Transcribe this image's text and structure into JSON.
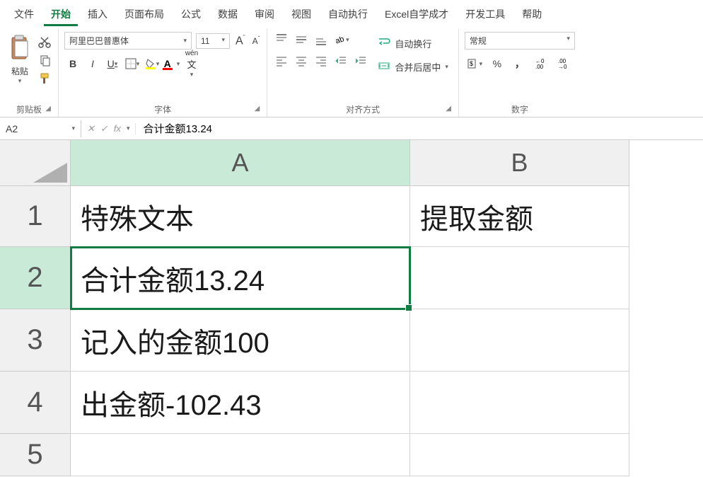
{
  "menu": {
    "items": [
      "文件",
      "开始",
      "插入",
      "页面布局",
      "公式",
      "数据",
      "审阅",
      "视图",
      "自动执行",
      "Excel自学成才",
      "开发工具",
      "帮助"
    ],
    "active_index": 1
  },
  "ribbon": {
    "clipboard": {
      "paste_label": "粘贴",
      "group_label": "剪贴板"
    },
    "font": {
      "font_name": "阿里巴巴普惠体",
      "font_size": "11",
      "group_label": "字体",
      "bold": "B",
      "italic": "I",
      "underline": "U",
      "wen": "wén"
    },
    "alignment": {
      "wrap_label": "自动换行",
      "merge_label": "合并后居中",
      "group_label": "对齐方式"
    },
    "number": {
      "format": "常规",
      "percent": "%",
      "comma": "，",
      "group_label": "数字"
    }
  },
  "formula_bar": {
    "name_box": "A2",
    "fx": "fx",
    "formula": "合计金额13.24"
  },
  "grid": {
    "columns": [
      "A",
      "B"
    ],
    "rows": [
      {
        "num": "1",
        "a": "特殊文本",
        "b": "提取金额"
      },
      {
        "num": "2",
        "a": "合计金额13.24",
        "b": ""
      },
      {
        "num": "3",
        "a": "记入的金额100",
        "b": ""
      },
      {
        "num": "4",
        "a": "出金额-102.43",
        "b": ""
      },
      {
        "num": "5",
        "a": "",
        "b": ""
      }
    ],
    "selected_cell": "A2"
  }
}
